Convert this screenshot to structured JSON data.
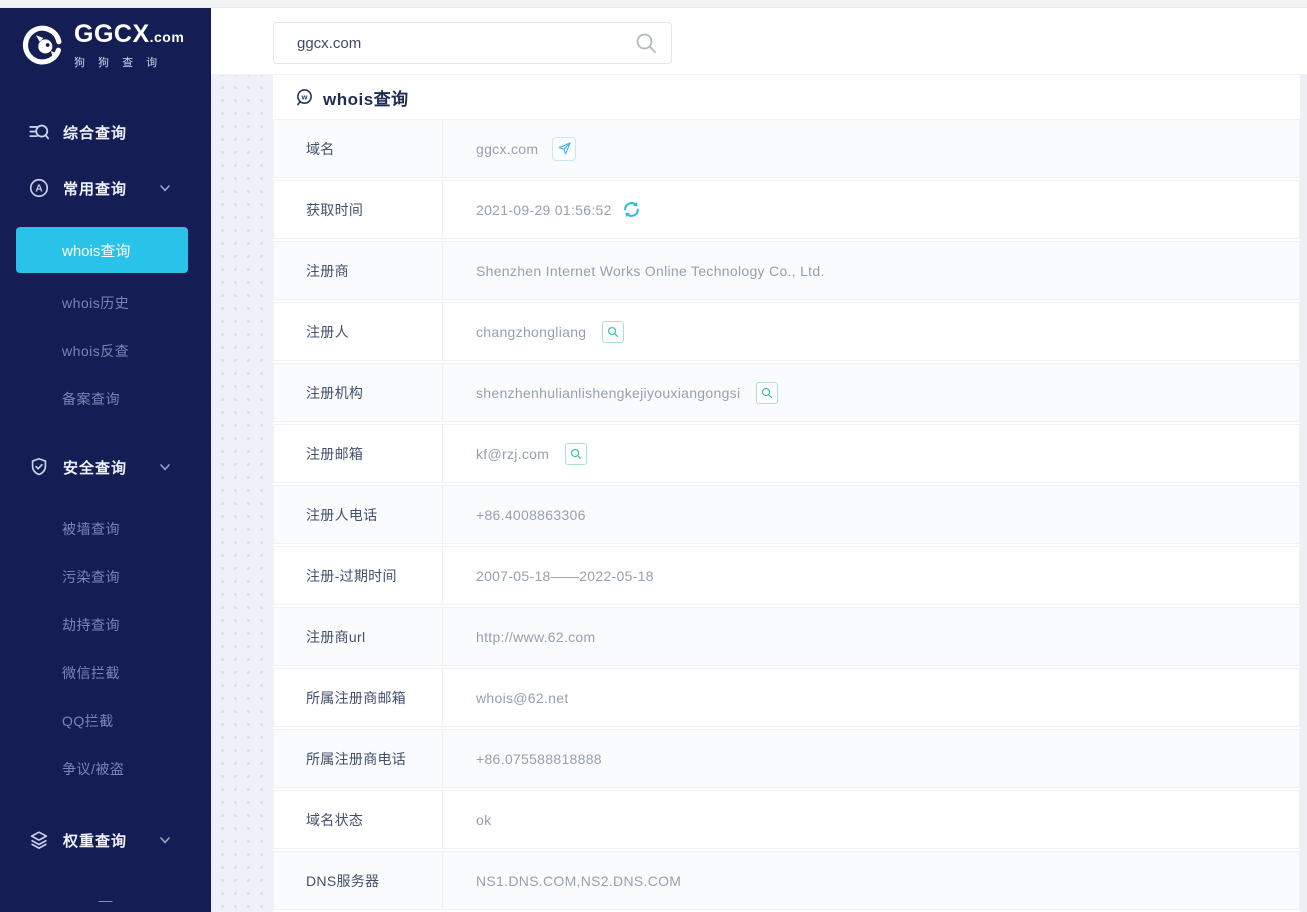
{
  "logo": {
    "brand": "GGCX",
    "suffix": ".com",
    "subtitle": "狗 狗 查 询"
  },
  "search": {
    "value": "ggcx.com"
  },
  "sidebar": {
    "groups": [
      {
        "label": "综合查询",
        "icon": "search-list-icon"
      },
      {
        "label": "常用查询",
        "icon": "circle-a-icon",
        "children": [
          "whois查询",
          "whois历史",
          "whois反查",
          "备案查询"
        ],
        "active_child": "whois查询"
      },
      {
        "label": "安全查询",
        "icon": "shield-check-icon",
        "children": [
          "被墙查询",
          "污染查询",
          "劫持查询",
          "微信拦截",
          "QQ拦截",
          "争议/被盗"
        ]
      },
      {
        "label": "权重查询",
        "icon": "layers-icon",
        "children": []
      }
    ],
    "footer_dash": "—"
  },
  "main": {
    "section_title": "whois查询",
    "whois_table": {
      "rows": [
        {
          "label": "域名",
          "value": "ggcx.com",
          "action_icon": "send"
        },
        {
          "label": "获取时间",
          "value": "2021-09-29 01:56:52",
          "action_icon": "refresh"
        },
        {
          "label": "注册商",
          "value": "Shenzhen Internet Works Online Technology Co., Ltd."
        },
        {
          "label": "注册人",
          "value": "changzhongliang",
          "action_icon": "search"
        },
        {
          "label": "注册机构",
          "value": "shenzhenhulianlishengkejiyouxiangongsi",
          "action_icon": "search"
        },
        {
          "label": "注册邮箱",
          "value": "kf@rzj.com",
          "action_icon": "search"
        },
        {
          "label": "注册人电话",
          "value": "+86.4008863306"
        },
        {
          "label": "注册-过期时间",
          "value": "2007-05-18——2022-05-18"
        },
        {
          "label": "注册商url",
          "value": "http://www.62.com"
        },
        {
          "label": "所属注册商邮箱",
          "value": "whois@62.net"
        },
        {
          "label": "所属注册商电话",
          "value": "+86.075588818888"
        },
        {
          "label": "域名状态",
          "value": "ok"
        },
        {
          "label": "DNS服务器",
          "value": "NS1.DNS.COM,NS2.DNS.COM"
        }
      ]
    }
  },
  "colors": {
    "sidebar_bg": "#151e54",
    "active_item": "#29c2e8",
    "accent_teal": "#2cc2ae",
    "accent_blue": "#4db0ef",
    "accent_cyan": "#2bc0d4",
    "title_navy": "#1e2b52"
  }
}
